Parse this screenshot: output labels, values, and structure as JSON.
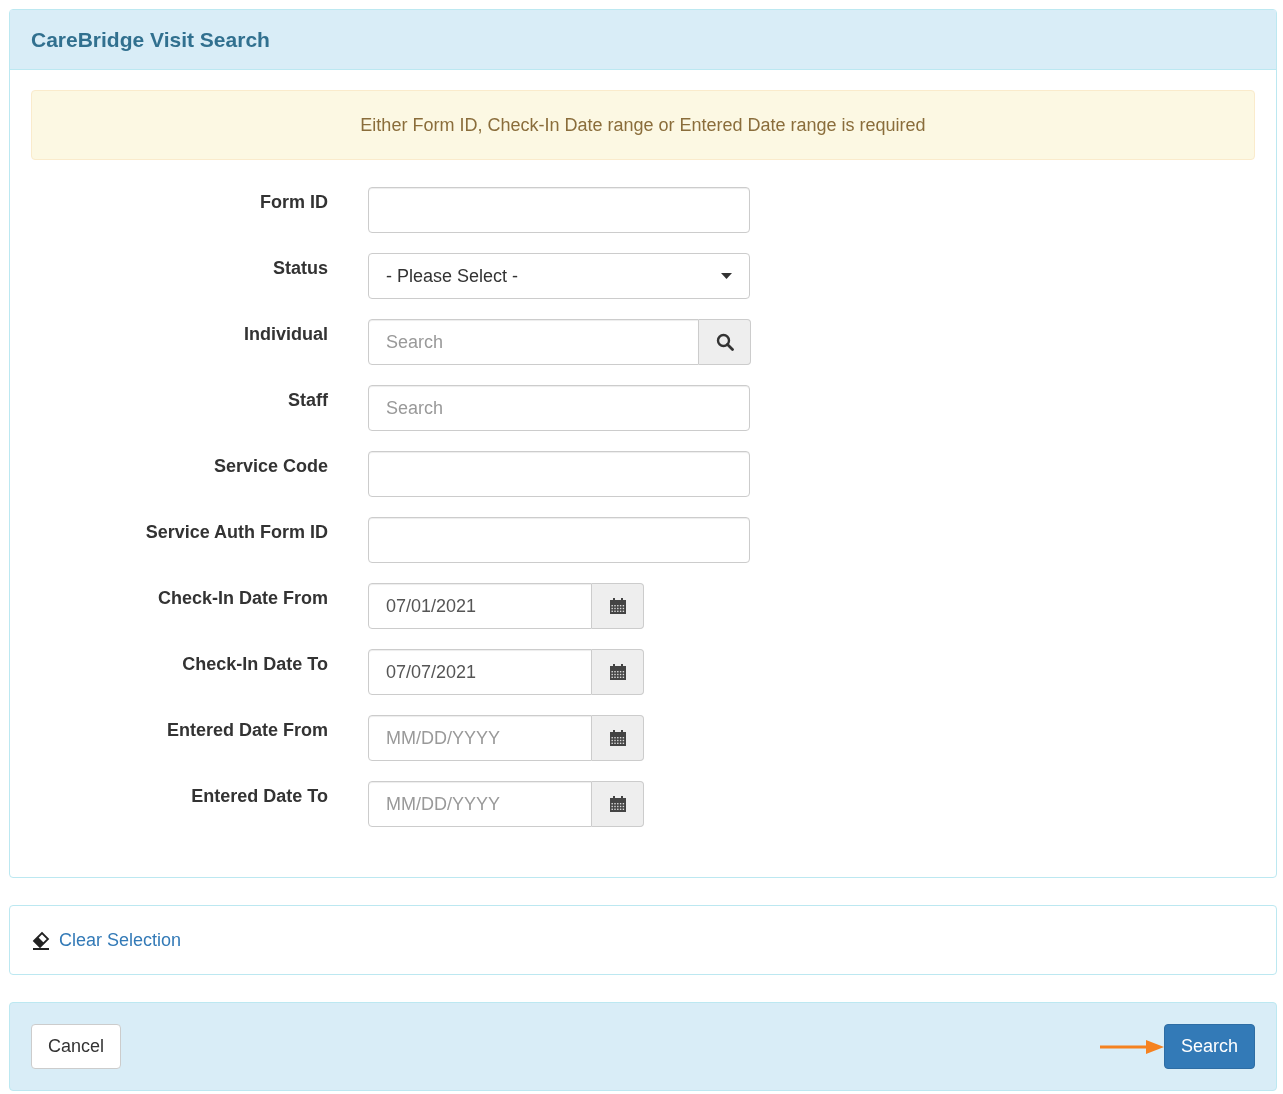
{
  "panel": {
    "title": "CareBridge Visit Search"
  },
  "alert": "Either Form ID, Check-In Date range or Entered Date range is required",
  "fields": [
    {
      "label": "Form ID",
      "kind": "text"
    },
    {
      "label": "Status",
      "kind": "select",
      "value": "- Please Select -"
    },
    {
      "label": "Individual",
      "kind": "search",
      "placeholder": "Search"
    },
    {
      "label": "Staff",
      "kind": "text",
      "placeholder": "Search"
    },
    {
      "label": "Service Code",
      "kind": "text"
    },
    {
      "label": "Service Auth Form ID",
      "kind": "text"
    },
    {
      "label": "Check-In Date From",
      "kind": "date",
      "value": "07/01/2021"
    },
    {
      "label": "Check-In Date To",
      "kind": "date",
      "value": "07/07/2021"
    },
    {
      "label": "Entered Date From",
      "kind": "date",
      "placeholder": "MM/DD/YYYY"
    },
    {
      "label": "Entered Date To",
      "kind": "date",
      "placeholder": "MM/DD/YYYY"
    }
  ],
  "clear_link": "Clear Selection",
  "footer": {
    "cancel": "Cancel",
    "search": "Search"
  }
}
